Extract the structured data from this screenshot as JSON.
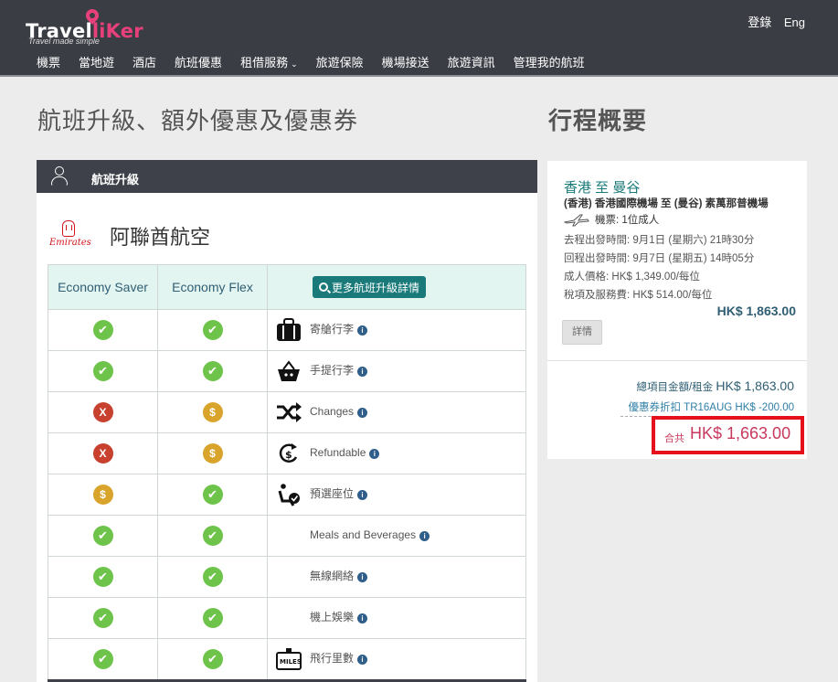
{
  "header": {
    "logo_text_white": "Travel",
    "logo_text_pink": "liKer",
    "logo_tagline": "Travel made simple",
    "login_label": "登錄",
    "lang_label": "Eng",
    "nav": [
      {
        "label": "機票"
      },
      {
        "label": "當地遊"
      },
      {
        "label": "酒店"
      },
      {
        "label": "航班優惠"
      },
      {
        "label": "租借服務"
      },
      {
        "label": "旅遊保險"
      },
      {
        "label": "機場接送"
      },
      {
        "label": "旅遊資訊"
      },
      {
        "label": "管理我的航班"
      }
    ]
  },
  "main": {
    "title": "航班升級、額外優惠及優惠券",
    "panel_label": "航班升級",
    "airline_logo_text": "Emirates",
    "airline_name": "阿聯酋航空",
    "columns": [
      "Economy Saver",
      "Economy Flex"
    ],
    "more_button": "更多航班升級詳情",
    "features": [
      {
        "label": "寄艙行李",
        "icon": "luggage-icon",
        "saver": "yes",
        "flex": "yes"
      },
      {
        "label": "手提行李",
        "icon": "basket-icon",
        "saver": "yes",
        "flex": "yes"
      },
      {
        "label": "Changes",
        "icon": "shuffle-icon",
        "saver": "no",
        "flex": "fee"
      },
      {
        "label": "Refundable",
        "icon": "refund-icon",
        "saver": "no",
        "flex": "fee"
      },
      {
        "label": "預選座位",
        "icon": "seat-icon",
        "saver": "fee",
        "flex": "yes"
      },
      {
        "label": "Meals and Beverages",
        "icon": "",
        "saver": "yes",
        "flex": "yes"
      },
      {
        "label": "無線網絡",
        "icon": "",
        "saver": "yes",
        "flex": "yes"
      },
      {
        "label": "機上娛樂",
        "icon": "",
        "saver": "yes",
        "flex": "yes"
      },
      {
        "label": "飛行里數",
        "icon": "miles-icon",
        "saver": "yes",
        "flex": "yes"
      }
    ],
    "status_glyphs": {
      "yes": "✔",
      "no": "X",
      "fee": "$"
    }
  },
  "sidebar": {
    "title": "行程概要",
    "route": "香港  至  曼谷",
    "airports": "(香港) 香港國際機場  至  (曼谷) 素萬那普機場",
    "pax": "機票: 1位成人",
    "depart": "去程出發時間: 9月1日 (星期六) 21時30分",
    "return": "回程出發時間: 9月7日 (星期五) 14時05分",
    "adult_price": "成人價格: HK$ 1,349.00/每位",
    "tax": "稅項及服務費: HK$ 514.00/每位",
    "subtotal": "HK$ 1,863.00",
    "details_button": "詳情",
    "sum_label": "總項目金額/租金",
    "sum_value": "HK$ 1,863.00",
    "coupon": "優惠券折扣 TR16AUG HK$ -200.00",
    "total_label": "合共",
    "total_value": "HK$ 1,663.00"
  },
  "colors": {
    "header_bg": "#3a3d44",
    "brand_pink": "#e8407a",
    "teal": "#1a7a7a",
    "yes_green": "#6ec34a",
    "no_red": "#c8412e",
    "fee_gold": "#d9a42b",
    "highlight_red": "#e6101c"
  }
}
